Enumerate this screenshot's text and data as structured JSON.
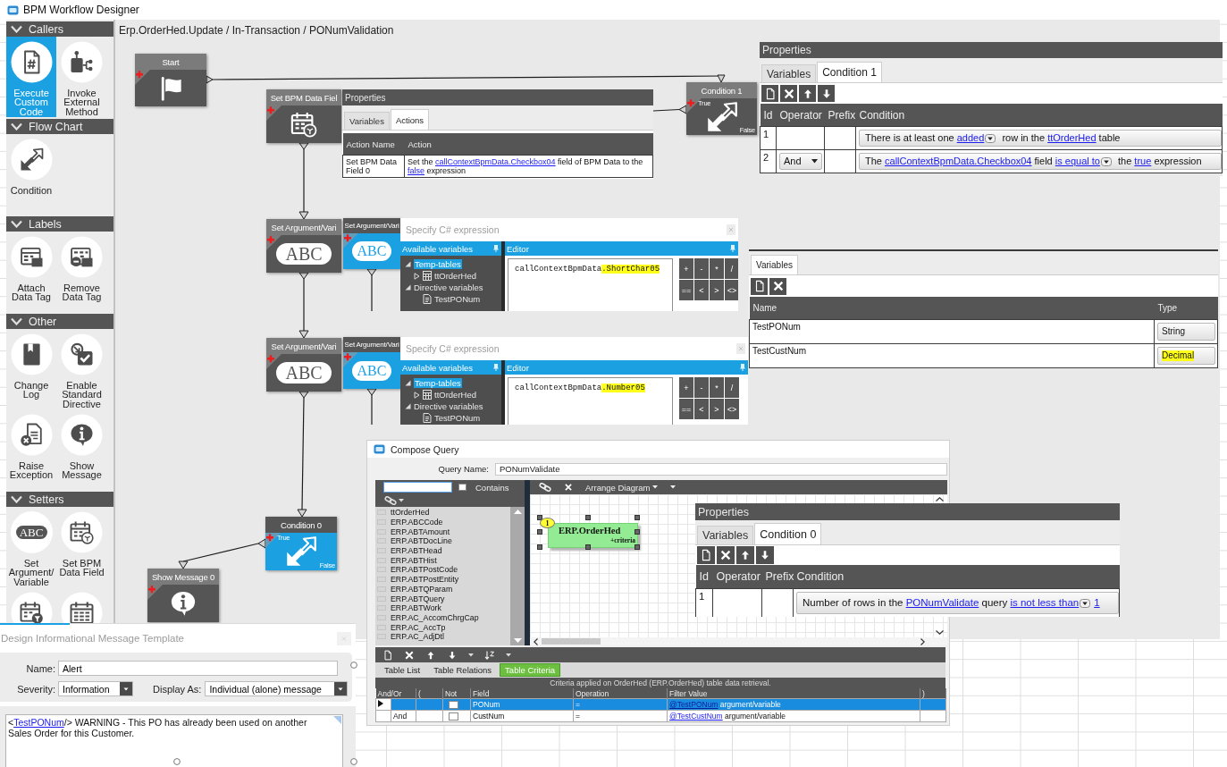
{
  "window": {
    "title": "BPM Workflow Designer"
  },
  "palette": [
    {
      "title": "Callers",
      "expanded": true,
      "items": [
        {
          "label": "Execute Custom Code",
          "kind": "custom-code",
          "selected": true
        },
        {
          "label": "Invoke External Method",
          "kind": "external-method",
          "selected": false
        }
      ]
    },
    {
      "title": "Flow Chart",
      "expanded": true,
      "items": [
        {
          "label": "Condition",
          "kind": "condition",
          "selected": false
        }
      ]
    },
    {
      "title": "Labels",
      "expanded": true,
      "items": [
        {
          "label": "Attach Data Tag",
          "kind": "attach-tag",
          "selected": false
        },
        {
          "label": "Remove Data Tag",
          "kind": "remove-tag",
          "selected": false
        }
      ]
    },
    {
      "title": "Other",
      "expanded": true,
      "items": [
        {
          "label": "Change Log",
          "kind": "change-log",
          "selected": false
        },
        {
          "label": "Enable Standard Directive",
          "kind": "enable-directive",
          "selected": false
        },
        {
          "label": "Raise Exception",
          "kind": "raise-exception",
          "selected": false
        },
        {
          "label": "Show Message",
          "kind": "show-message",
          "selected": false
        }
      ]
    },
    {
      "title": "Setters",
      "expanded": true,
      "items": [
        {
          "label": "Set Argument/Variable",
          "kind": "set-argument",
          "icon_text": "ABC",
          "selected": false
        },
        {
          "label": "Set BPM Data Field",
          "kind": "set-field",
          "selected": false
        },
        {
          "kind": "calendar-filter",
          "selected": false
        },
        {
          "kind": "calendar",
          "selected": false
        }
      ]
    }
  ],
  "breadcrumb": "Erp.OrderHed.Update / In-Transaction / PONumValidation",
  "nodes": [
    {
      "title": "Start",
      "kind": "start",
      "selected": false
    },
    {
      "title": "Set BPM Data Fiel",
      "kind": "set-field",
      "selected": false
    },
    {
      "title": "Condition 1",
      "kind": "condition",
      "selected": false,
      "outputs": [
        "True",
        "False"
      ]
    },
    {
      "title": "Set Argument/Vari",
      "kind": "set-argument",
      "icon_text": "ABC",
      "selected": false
    },
    {
      "title": "Set Argument/Vari",
      "kind": "set-argument",
      "icon_text": "ABC",
      "selected": true
    },
    {
      "title": "Set Argument/Vari",
      "kind": "set-argument",
      "icon_text": "ABC",
      "selected": false
    },
    {
      "title": "Set Argument/Vari",
      "kind": "set-argument",
      "icon_text": "ABC",
      "selected": true
    },
    {
      "title": "Condition 0",
      "kind": "condition",
      "selected": true,
      "outputs": [
        "True",
        "False"
      ]
    },
    {
      "title": "Show Message 0",
      "kind": "show-message",
      "selected": false
    }
  ],
  "action_properties": {
    "title": "Properties",
    "tabs": [
      {
        "label": "Variables",
        "selected": false
      },
      {
        "label": "Actions",
        "selected": true
      }
    ],
    "columns": [
      "Action Name",
      "Action"
    ],
    "rows": [
      {
        "name": "Set BPM Data Field 0",
        "action": [
          {
            "kind": "text",
            "text": "Set the "
          },
          {
            "kind": "link",
            "text": "callContextBpmData.Checkbox04"
          },
          {
            "kind": "text",
            "text": " field of BPM Data to the "
          },
          {
            "kind": "link",
            "text": "false"
          },
          {
            "kind": "text",
            "text": " expression"
          }
        ]
      }
    ]
  },
  "condition_panels": [
    {
      "title": "Properties",
      "tabs": [
        {
          "label": "Variables",
          "selected": false
        },
        {
          "label": "Condition 1",
          "selected": true
        }
      ],
      "columns": [
        "Id",
        "Operator",
        "Prefix",
        "Condition"
      ],
      "rows": [
        {
          "id": "1",
          "condition": [
            {
              "kind": "text",
              "text": "There is at least one "
            },
            {
              "kind": "link",
              "text": "added"
            },
            {
              "kind": "dropdown"
            },
            {
              "kind": "text",
              "text": " row in the "
            },
            {
              "kind": "link",
              "text": "ttOrderHed"
            },
            {
              "kind": "text",
              "text": " table"
            }
          ]
        },
        {
          "id": "2",
          "operator": "And",
          "condition": [
            {
              "kind": "text",
              "text": "The "
            },
            {
              "kind": "link",
              "text": "callContextBpmData.Checkbox04"
            },
            {
              "kind": "text",
              "text": " field "
            },
            {
              "kind": "link",
              "text": "is equal to"
            },
            {
              "kind": "dropdown"
            },
            {
              "kind": "text",
              "text": " the "
            },
            {
              "kind": "link",
              "text": "true"
            },
            {
              "kind": "text",
              "text": " expression"
            }
          ]
        }
      ]
    },
    {
      "title": "Properties",
      "tabs": [
        {
          "label": "Variables",
          "selected": false
        },
        {
          "label": "Condition 0",
          "selected": true
        }
      ],
      "columns": [
        "Id",
        "Operator",
        "Prefix",
        "Condition"
      ],
      "rows": [
        {
          "id": "1",
          "condition": [
            {
              "kind": "text",
              "text": "Number of rows in the "
            },
            {
              "kind": "link",
              "text": "PONumValidate"
            },
            {
              "kind": "text",
              "text": " query "
            },
            {
              "kind": "link",
              "text": "is not less than"
            },
            {
              "kind": "dropdown"
            },
            {
              "kind": "link",
              "text": "1"
            }
          ]
        }
      ]
    }
  ],
  "variables_panel": {
    "tabs": [
      {
        "label": "Variables",
        "selected": true
      }
    ],
    "columns": [
      "Name",
      "Type"
    ],
    "rows": [
      {
        "name": "TestPONum",
        "type": "String",
        "highlighted": false
      },
      {
        "name": "TestCustNum",
        "type": "Decimal",
        "highlighted": true
      }
    ]
  },
  "expression_editors": [
    {
      "title": "Specify C# expression",
      "variables_title": "Available variables",
      "editor_title": "Editor",
      "tree": [
        {
          "label": "Temp-tables",
          "expanded": true,
          "selected": true,
          "children": [
            {
              "label": "ttOrderHed",
              "kind": "table",
              "expanded": false,
              "selected": false
            }
          ]
        },
        {
          "label": "Directive variables",
          "expanded": true,
          "selected": false,
          "children": [
            {
              "label": "TestPONum",
              "kind": "variable",
              "selected": false
            }
          ]
        }
      ],
      "code": [
        {
          "text": "callContextBpmData",
          "highlighted": false
        },
        {
          "text": ".ShortChar05",
          "highlighted": true
        }
      ],
      "operators": [
        "+",
        "-",
        "*",
        "/",
        "==",
        "<",
        ">",
        "<>"
      ]
    },
    {
      "title": "Specify C# expression",
      "variables_title": "Available variables",
      "editor_title": "Editor",
      "tree": [
        {
          "label": "Temp-tables",
          "expanded": true,
          "selected": true,
          "children": [
            {
              "label": "ttOrderHed",
              "kind": "table",
              "expanded": false,
              "selected": false
            }
          ]
        },
        {
          "label": "Directive variables",
          "expanded": true,
          "selected": false,
          "children": [
            {
              "label": "TestPONum",
              "kind": "variable",
              "selected": false
            }
          ]
        }
      ],
      "code": [
        {
          "text": "callContextBpmData",
          "highlighted": false
        },
        {
          "text": ".Number05",
          "highlighted": true
        }
      ],
      "operators": [
        "+",
        "-",
        "*",
        "/",
        "==",
        "<",
        ">",
        "<>"
      ]
    }
  ],
  "compose_query": {
    "title": "Compose Query",
    "query_name_label": "Query Name:",
    "query_name": "PONumValidate",
    "contains_label": "Contains",
    "contains_checked": false,
    "tables": [
      "ttOrderHed",
      "ERP.ABCCode",
      "ERP.ABTAmount",
      "ERP.ABTDocLine",
      "ERP.ABTHead",
      "ERP.ABTHist",
      "ERP.ABTPostCode",
      "ERP.ABTPostEntity",
      "ERP.ABTQParam",
      "ERP.ABTQuery",
      "ERP.ABTWork",
      "ERP.AC_AccomChrgCap",
      "ERP.AC_AccTp",
      "ERP.AC_AdjDtl"
    ],
    "arrange_label": "Arrange Diagram",
    "diagram_table": {
      "number": "1",
      "name": "ERP.OrderHed",
      "criteria": "+criteria"
    },
    "tabs": [
      {
        "label": "Table List",
        "selected": false
      },
      {
        "label": "Table Relations",
        "selected": false
      },
      {
        "label": "Table Criteria",
        "selected": true
      }
    ],
    "caption": "Criteria applied on OrderHed (ERP.OrderHed) table data retrieval.",
    "columns": [
      "And/Or",
      "(",
      "Not",
      "Field",
      "Operation",
      "Filter Value",
      ")"
    ],
    "rows": [
      {
        "selected": true,
        "not": false,
        "field": "PONum",
        "operation": "=",
        "filter": [
          {
            "kind": "link",
            "text": "@TestPONum"
          },
          {
            "kind": "text",
            "text": " argument/variable"
          }
        ]
      },
      {
        "selected": false,
        "and_or": "And",
        "not": false,
        "field": "CustNum",
        "operation": "=",
        "filter": [
          {
            "kind": "link",
            "text": "@TestCustNum"
          },
          {
            "kind": "text",
            "text": " argument/variable"
          }
        ]
      }
    ]
  },
  "message_template": {
    "title": "Design Informational Message Template",
    "fields": [
      {
        "label": "Name:",
        "value": "Alert",
        "kind": "text"
      },
      {
        "label": "Severity:",
        "value": "Information",
        "kind": "dropdown"
      },
      {
        "label": "Display As:",
        "value": "Individual (alone) message",
        "kind": "dropdown"
      }
    ],
    "message": [
      {
        "kind": "text",
        "text": "<"
      },
      {
        "kind": "link",
        "text": "TestPONum"
      },
      {
        "kind": "text",
        "text": "/> WARNING - This PO has already been used on another Sales Order for this Customer."
      }
    ]
  }
}
